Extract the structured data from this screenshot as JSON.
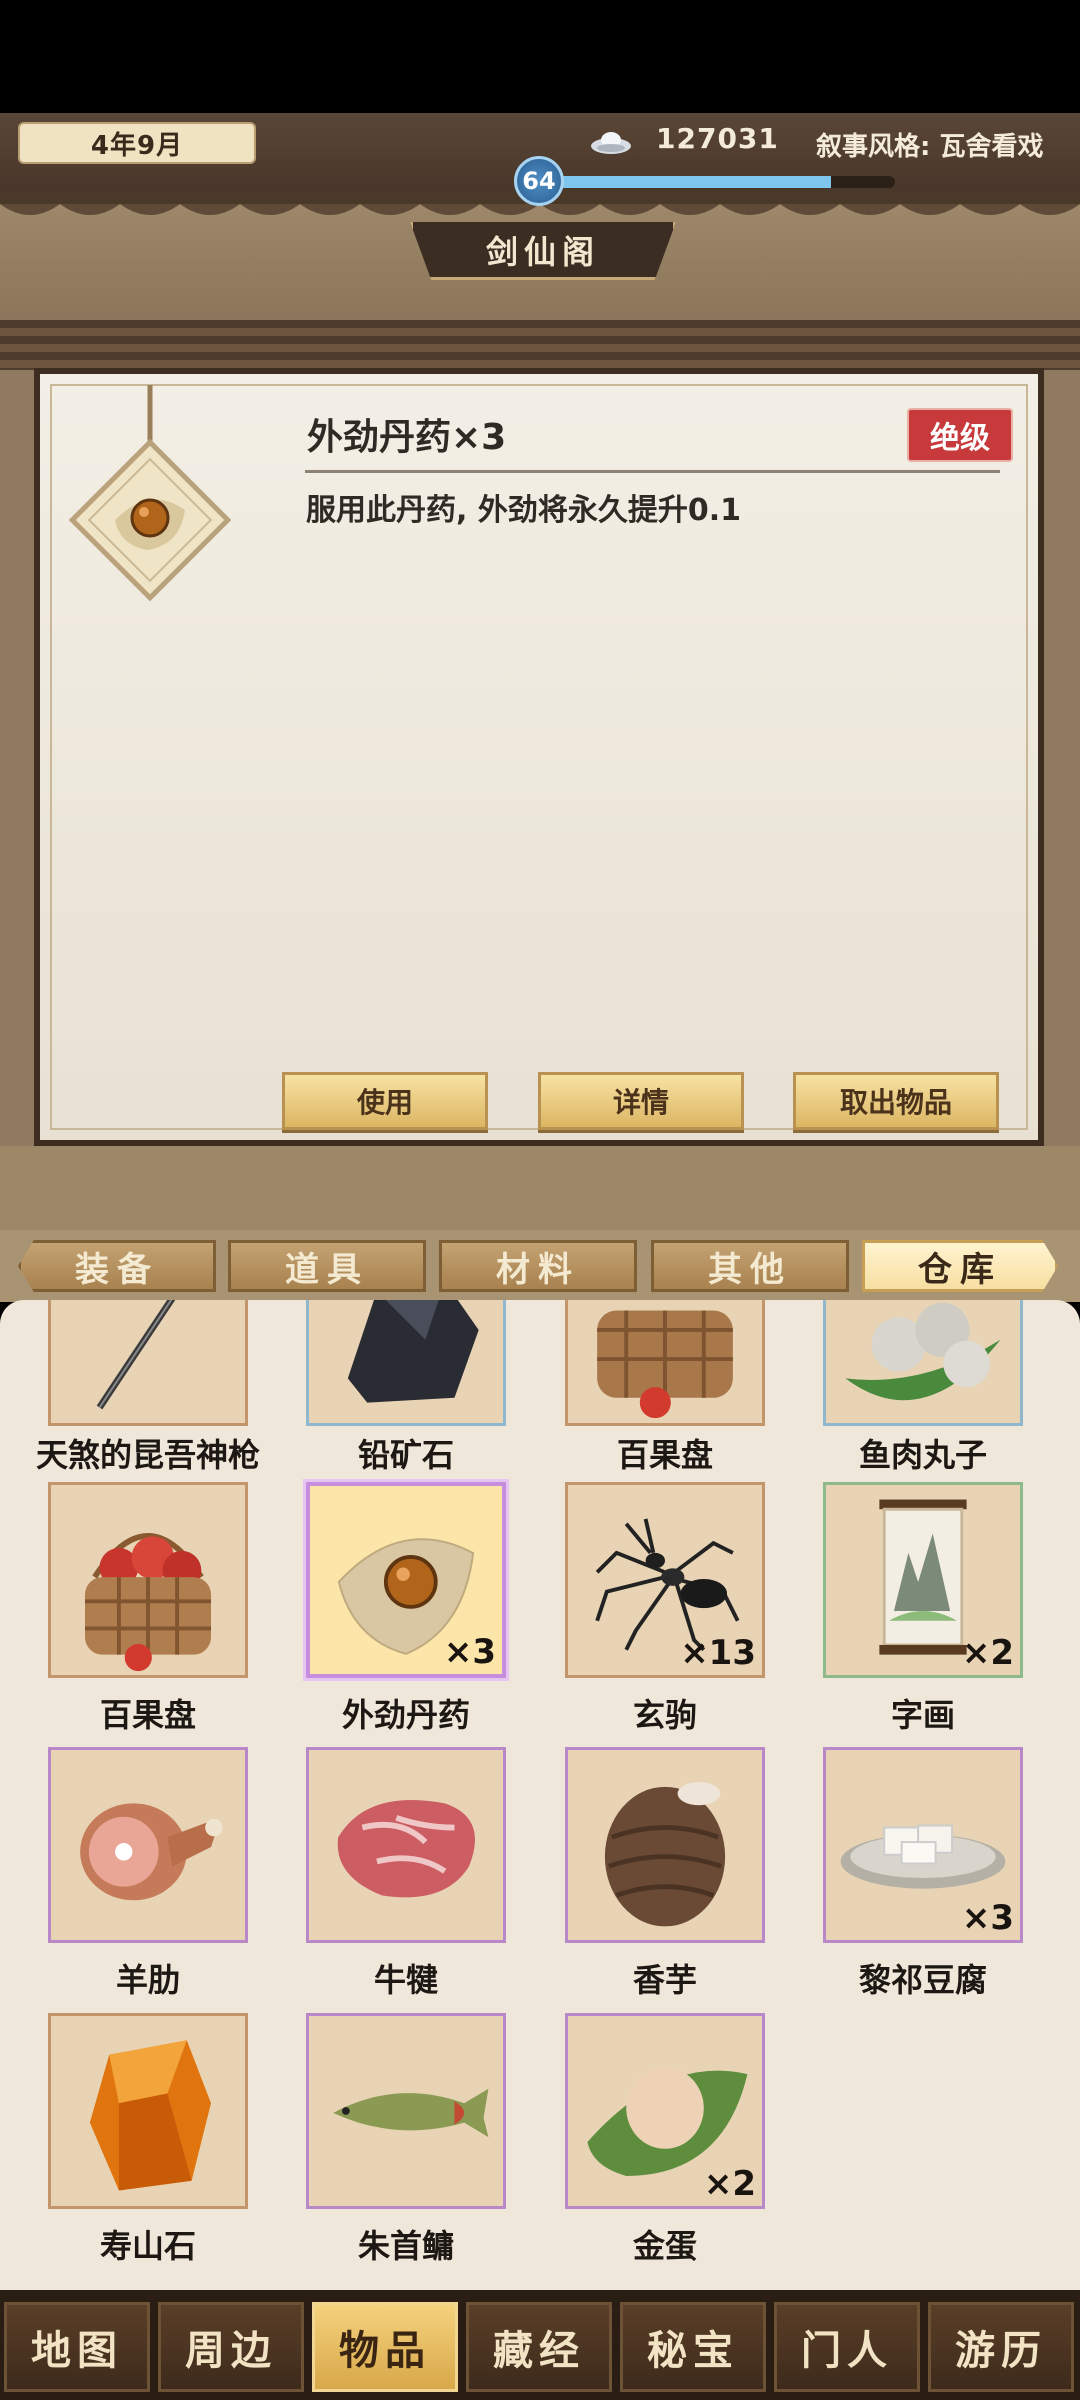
{
  "header": {
    "date": "4年9月",
    "silver": "127031",
    "narrative_style": "叙事风格: 瓦舍看戏",
    "level": "64",
    "level_progress": 0.82,
    "location_title": "剑仙阁"
  },
  "detail": {
    "item_title": "外劲丹药×3",
    "grade": "绝级",
    "description": "服用此丹药, 外劲将永久提升0.1",
    "buttons": {
      "use": "使用",
      "details": "详情",
      "take_out": "取出物品"
    }
  },
  "tabs": [
    {
      "label": "装备"
    },
    {
      "label": "道具"
    },
    {
      "label": "材料"
    },
    {
      "label": "其他"
    },
    {
      "label": "仓库",
      "active": true
    }
  ],
  "items": [
    {
      "name": "天煞的昆吾神枪",
      "icon": "spear-icon",
      "qty": ""
    },
    {
      "name": "铅矿石",
      "icon": "ore-icon",
      "qty": ""
    },
    {
      "name": "百果盘",
      "icon": "fruit-basket-icon",
      "qty": ""
    },
    {
      "name": "鱼肉丸子",
      "icon": "fishball-icon",
      "qty": ""
    },
    {
      "name": "百果盘",
      "icon": "fruit-basket-icon",
      "qty": ""
    },
    {
      "name": "外劲丹药",
      "icon": "pill-icon",
      "qty": "×3",
      "selected": true
    },
    {
      "name": "玄驹",
      "icon": "ant-icon",
      "qty": "×13"
    },
    {
      "name": "字画",
      "icon": "scroll-painting-icon",
      "qty": "×2"
    },
    {
      "name": "羊肋",
      "icon": "ham-icon",
      "qty": ""
    },
    {
      "name": "牛犍",
      "icon": "steak-icon",
      "qty": ""
    },
    {
      "name": "香芋",
      "icon": "taro-icon",
      "qty": ""
    },
    {
      "name": "黎祁豆腐",
      "icon": "tofu-icon",
      "qty": "×3"
    },
    {
      "name": "寿山石",
      "icon": "amber-stone-icon",
      "qty": ""
    },
    {
      "name": "朱首鳙",
      "icon": "fish-icon",
      "qty": ""
    },
    {
      "name": "金蛋",
      "icon": "egg-icon",
      "qty": "×2"
    }
  ],
  "nav": [
    {
      "label": "地图"
    },
    {
      "label": "周边"
    },
    {
      "label": "物品",
      "active": true
    },
    {
      "label": "藏经"
    },
    {
      "label": "秘宝"
    },
    {
      "label": "门人"
    },
    {
      "label": "游历"
    }
  ],
  "colors": {
    "grade_red": "#c7393a",
    "level_blue": "#7fc6ee",
    "accent_gold": "#f5d27d"
  }
}
